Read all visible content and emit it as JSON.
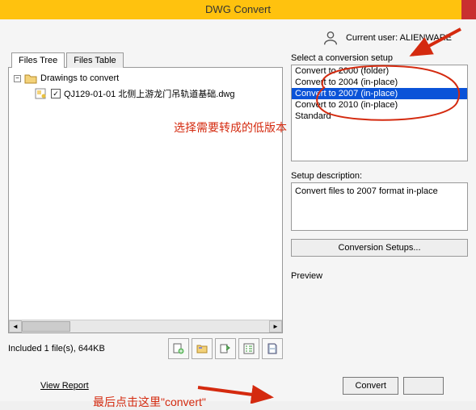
{
  "window": {
    "title": "DWG Convert"
  },
  "user": {
    "label": "Current user:",
    "name": "ALIENWARE"
  },
  "tabs": {
    "files_tree": "Files Tree",
    "files_table": "Files Table"
  },
  "tree": {
    "expander": "−",
    "root_label": "Drawings to convert",
    "check": "✓",
    "file_label": "QJ129-01-01 北侧上游龙门吊轨道基础.dwg"
  },
  "status": {
    "text": "Included 1 file(s), 644KB"
  },
  "right": {
    "select_label": "Select a conversion setup",
    "setups": [
      "Convert to 2000 (folder)",
      "Convert to 2004 (in-place)",
      "Convert to 2007 (in-place)",
      "Convert to 2010 (in-place)",
      "Standard"
    ],
    "desc_label": "Setup description:",
    "desc_text": "Convert files to 2007 format in-place",
    "setups_btn": "Conversion Setups...",
    "preview_label": "Preview"
  },
  "bottom": {
    "view_report": "View Report",
    "convert": "Convert"
  },
  "annotations": {
    "red1": "选择需要转成的低版本",
    "red2": "最后点击这里\"convert\""
  },
  "colors": {
    "accent": "#FFC20E",
    "select": "#0a53d8",
    "red": "#d42a0f"
  }
}
